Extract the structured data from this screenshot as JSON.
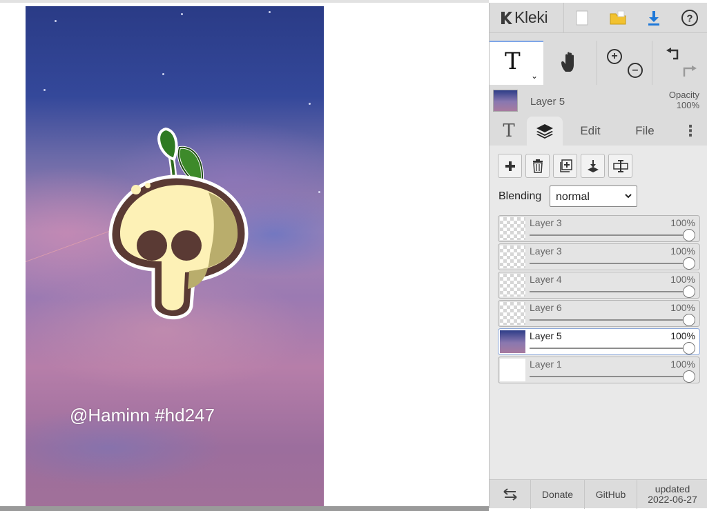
{
  "canvas": {
    "watermark": "@Haminn #hd247"
  },
  "topbar": {
    "app_name": "Kleki",
    "icons": [
      "new-image-icon",
      "open-folder-icon",
      "download-icon",
      "help-icon"
    ]
  },
  "tools": {
    "active_tool": "T",
    "icons": [
      "text-tool-icon",
      "hand-tool-icon",
      "zoom-in-icon",
      "zoom-out-icon",
      "undo-icon",
      "redo-icon"
    ]
  },
  "layer_header": {
    "name": "Layer 5",
    "opacity_label": "Opacity",
    "opacity_value": "100%"
  },
  "tabs": {
    "text_tab": "T",
    "edit": "Edit",
    "file": "File"
  },
  "layers_panel": {
    "buttons": [
      "add-layer-icon",
      "delete-layer-icon",
      "duplicate-layer-icon",
      "merge-down-icon",
      "rename-layer-icon"
    ],
    "blending_label": "Blending",
    "blending_value": "normal",
    "layers": [
      {
        "name": "Layer 3",
        "opacity": "100%",
        "opacity_fraction": 1.0,
        "active": false
      },
      {
        "name": "Layer 3",
        "opacity": "100%",
        "opacity_fraction": 1.0,
        "active": false
      },
      {
        "name": "Layer 4",
        "opacity": "100%",
        "opacity_fraction": 1.0,
        "active": false
      },
      {
        "name": "Layer 6",
        "opacity": "100%",
        "opacity_fraction": 1.0,
        "active": false
      },
      {
        "name": "Layer 5",
        "opacity": "100%",
        "opacity_fraction": 1.0,
        "active": true
      },
      {
        "name": "Layer 1",
        "opacity": "100%",
        "opacity_fraction": 1.0,
        "active": false
      }
    ]
  },
  "footer": {
    "swap_icon": "swap-arrows-icon",
    "donate": "Donate",
    "github": "GitHub",
    "updated_label": "updated",
    "updated_date": "2022-06-27"
  },
  "colors": {
    "panel_bg": "#dcdcdc",
    "accent": "#7fa6e8",
    "download_icon": "#1e78d8",
    "folder_icon": "#f2c230"
  }
}
